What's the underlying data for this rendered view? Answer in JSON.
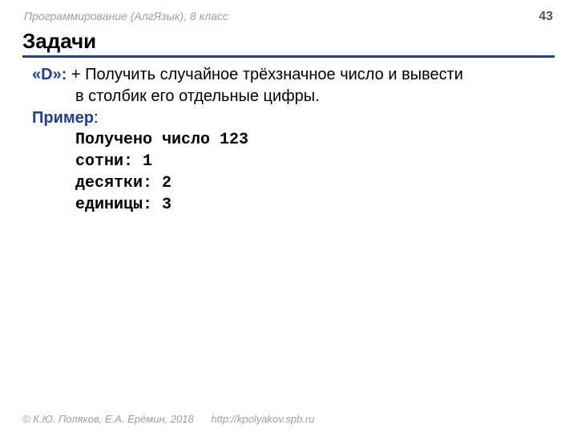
{
  "header": {
    "course": "Программирование (АлгЯзык), 8 класс",
    "page": "43"
  },
  "title": "Задачи",
  "problem": {
    "label": "«D»:",
    "text_line1": " + Получить случайное трёхзначное число и вывести",
    "text_line2": "в столбик его отдельные цифры."
  },
  "example_label": "Пример",
  "example_colon": ":",
  "output": {
    "line1": "Получено число 123",
    "line2": "сотни: 1",
    "line3": "десятки: 2",
    "line4": "единицы: 3"
  },
  "footer": {
    "copyright": "© К.Ю. Поляков, Е.А. Ерёмин, 2018",
    "url": "http://kpolyakov.spb.ru"
  }
}
